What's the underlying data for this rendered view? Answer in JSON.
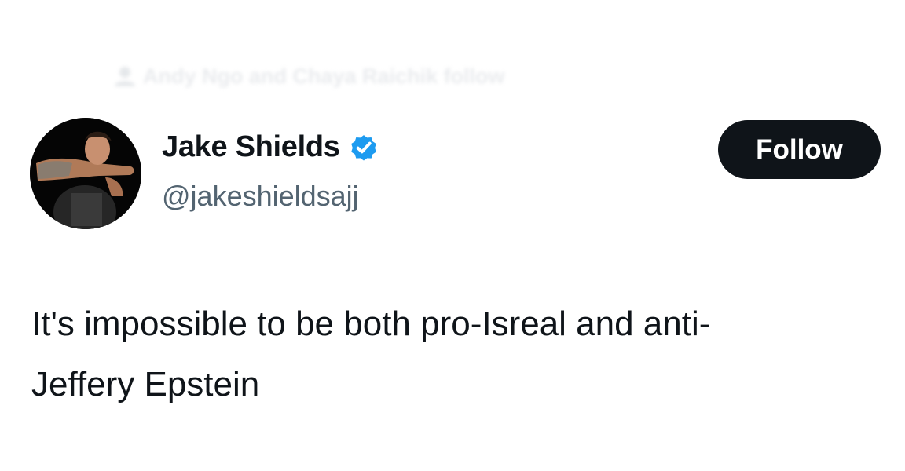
{
  "social_context": {
    "text": "Andy Ngo and Chaya Raichik follow",
    "icon": "person-icon"
  },
  "author": {
    "name": "Jake Shields",
    "handle": "@jakeshieldsajj",
    "verified": true,
    "verified_icon": "verified-badge-icon",
    "verified_color": "#1d9bf0"
  },
  "follow_button": {
    "label": "Follow",
    "background": "#0f1419",
    "text_color": "#ffffff"
  },
  "tweet": {
    "lines": [
      "It's impossible to be both pro-Isreal and anti-",
      "Jeffery Epstein"
    ]
  },
  "colors": {
    "text_primary": "#0f1419",
    "text_secondary": "#536471",
    "background": "#ffffff"
  }
}
